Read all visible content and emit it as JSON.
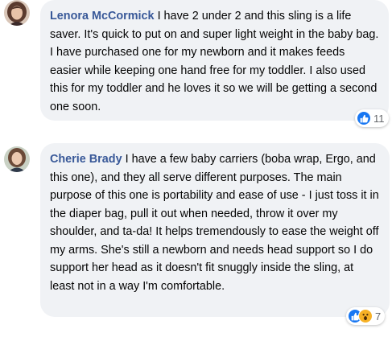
{
  "comments": [
    {
      "author": "Lenora McCormick",
      "text": "I have 2 under 2 and this sling is a life saver. It's quick to put on and super light weight in the baby bag. I have purchased one for my newborn and it makes feeds easier while keeping one hand free for my toddler. I also used this for my toddler and he loves it so we will be getting a second one soon.",
      "reactions": {
        "icons": [
          "like-icon"
        ],
        "count": "11"
      }
    },
    {
      "author": "Cherie Brady",
      "text": "I have a few baby carriers (boba wrap, Ergo, and this one), and they all serve different purposes. The main purpose of this one is portability and ease of use - I just toss it in the diaper bag, pull it out when needed, throw it over my shoulder, and ta-da! It helps tremendously to ease the weight off my arms. She's still a newborn and needs head support so I do support her head as it doesn't fit snuggly inside the sling, at least not in a way I'm comfortable.",
      "reactions": {
        "icons": [
          "like-icon",
          "wow-icon"
        ],
        "count": "7"
      }
    }
  ],
  "colors": {
    "author": "#385898",
    "bubble": "#f0f2f5",
    "like": "#1877f2",
    "wow": "#f7b125"
  }
}
